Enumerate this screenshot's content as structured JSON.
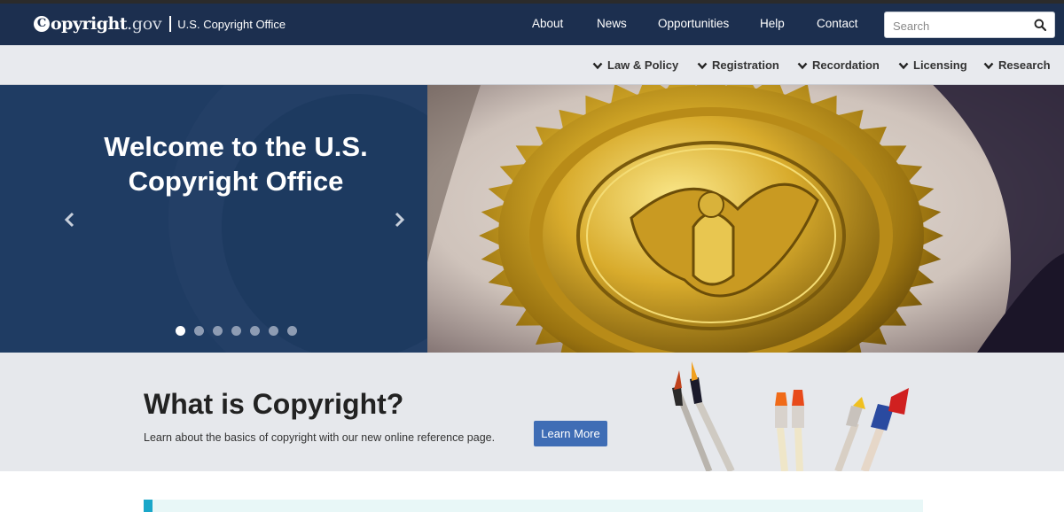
{
  "header": {
    "logo_bold": "opyright",
    "logo_mark": "C",
    "logo_suffix": ".gov",
    "office_name": "U.S. Copyright Office",
    "nav": [
      "About",
      "News",
      "Opportunities",
      "Help",
      "Contact"
    ],
    "search": {
      "placeholder": "Search",
      "icon": "search-icon"
    }
  },
  "subnav": {
    "items": [
      "Law & Policy",
      "Registration",
      "Recordation",
      "Licensing",
      "Research"
    ],
    "icon": "chevron-down-icon"
  },
  "hero": {
    "title": "Welcome to the U.S. Copyright Office",
    "slide_count": 7,
    "active_slide": 1,
    "image": "gold-copyright-seal"
  },
  "band": {
    "title": "What is Copyright?",
    "text": "Learn about the basics of copyright with our new online reference page.",
    "button": "Learn More",
    "image": "paint-brushes"
  },
  "colors": {
    "header_bg": "#1c2f4f",
    "subnav_bg": "#e8eaee",
    "hero_bg": "#1f3c63",
    "button_bg": "#3f6db5",
    "accent": "#1aa7c9"
  }
}
